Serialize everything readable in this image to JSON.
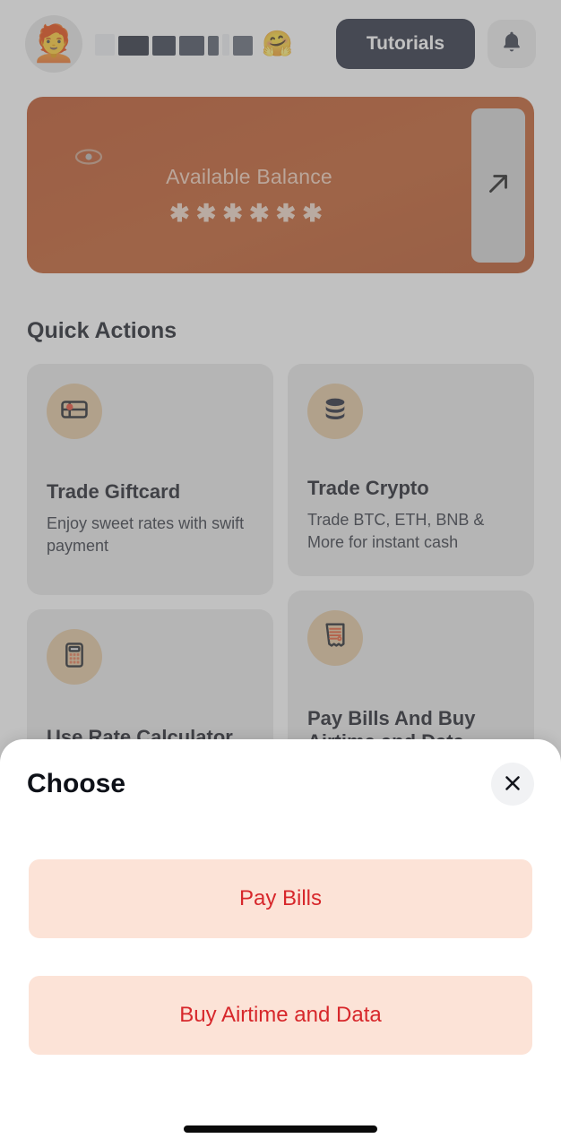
{
  "header": {
    "avatar_icon": "avatar-memoji-person-with-glasses",
    "greeting_redacted": true,
    "greeting_emoji": "🤗",
    "tutorials_label": "Tutorials",
    "bell_icon": "bell-icon"
  },
  "balance": {
    "eye_icon": "eye-icon",
    "label": "Available Balance",
    "amount_masked": "✱✱✱✱✱✱",
    "expand_icon": "arrow-up-right-icon",
    "card_color": "#bd4f1e"
  },
  "quick_actions": {
    "section_title": "Quick Actions",
    "items": [
      {
        "icon": "giftcard-icon",
        "title": "Trade Giftcard",
        "subtitle": "Enjoy sweet rates with swift payment"
      },
      {
        "icon": "coins-stack-icon",
        "title": "Trade Crypto",
        "subtitle": "Trade BTC, ETH, BNB & More for instant cash"
      },
      {
        "icon": "calculator-icon",
        "title": "Use Rate Calculator",
        "subtitle": ""
      },
      {
        "icon": "receipt-icon",
        "title": "Pay Bills And Buy Airtime and Data",
        "subtitle": ""
      }
    ]
  },
  "sheet": {
    "title": "Choose",
    "close_icon": "close-icon",
    "options": [
      {
        "label": "Pay Bills"
      },
      {
        "label": "Buy Airtime and Data"
      }
    ],
    "option_text_color": "#d7272b",
    "option_bg_color": "#fce3d7"
  }
}
